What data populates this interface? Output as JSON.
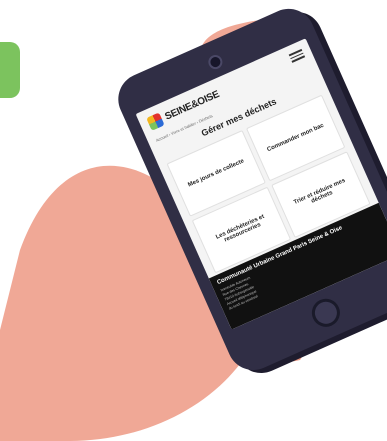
{
  "site": {
    "logo_text": "SEINE&OISE"
  },
  "breadcrumb": "Accueil › Vivre et habiter › Déchets",
  "page_title": "Gérer mes déchets",
  "tiles": [
    {
      "label": "Mes jours de collecte"
    },
    {
      "label": "Commander mon bac"
    },
    {
      "label": "Les déchèteries et ressourceries"
    },
    {
      "label": "Trier et réduire mes déchets"
    }
  ],
  "footer": {
    "title": "Communauté Urbaine Grand Paris Seine & Oise",
    "lines": [
      "Immeuble Autoneum",
      "Rue des Chevries",
      "78410 Aubergenville",
      "Accueil téléphonique",
      "du lundi au vendredi"
    ]
  },
  "colors": {
    "accent_green": "#7cc35e",
    "phone": "#302e45",
    "hand": "#f0a896"
  }
}
